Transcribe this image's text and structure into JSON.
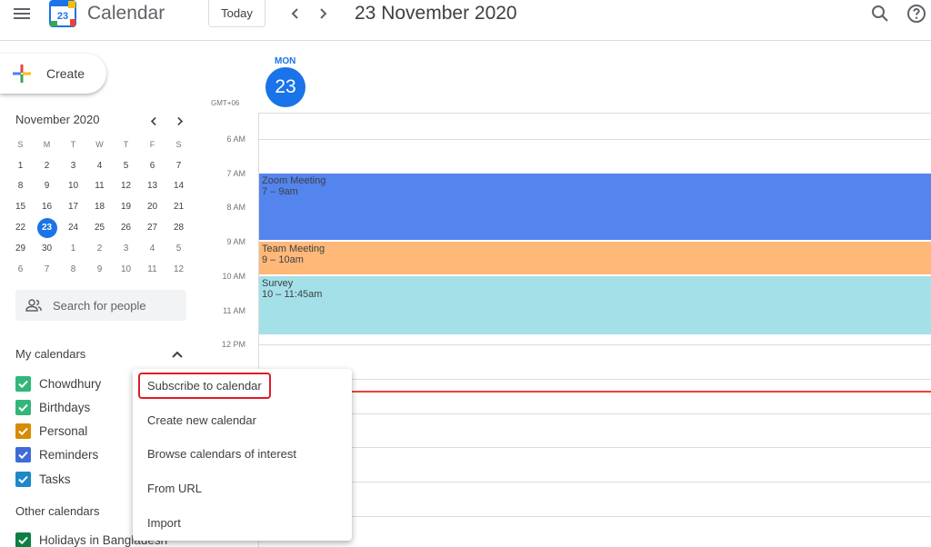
{
  "header": {
    "app_title": "Calendar",
    "logo_day": "23",
    "today_label": "Today",
    "date_title": "23 November 2020"
  },
  "sidebar": {
    "create_label": "Create",
    "mini_calendar": {
      "month_label": "November 2020",
      "weekdays": [
        "S",
        "M",
        "T",
        "W",
        "T",
        "F",
        "S"
      ],
      "weeks": [
        [
          "1",
          "2",
          "3",
          "4",
          "5",
          "6",
          "7"
        ],
        [
          "8",
          "9",
          "10",
          "11",
          "12",
          "13",
          "14"
        ],
        [
          "15",
          "16",
          "17",
          "18",
          "19",
          "20",
          "21"
        ],
        [
          "22",
          "23",
          "24",
          "25",
          "26",
          "27",
          "28"
        ],
        [
          "29",
          "30",
          "1",
          "2",
          "3",
          "4",
          "5"
        ],
        [
          "6",
          "7",
          "8",
          "9",
          "10",
          "11",
          "12"
        ]
      ],
      "selected": "23"
    },
    "people_search_placeholder": "Search for people",
    "my_calendars_title": "My calendars",
    "my_calendars": [
      {
        "label": "Chowdhury",
        "color": "#33b679"
      },
      {
        "label": "Birthdays",
        "color": "#33b679"
      },
      {
        "label": "Personal",
        "color": "#d88b00"
      },
      {
        "label": "Reminders",
        "color": "#3f6ad8"
      },
      {
        "label": "Tasks",
        "color": "#1e88c8"
      }
    ],
    "other_calendars_title": "Other calendars",
    "other_calendars": [
      {
        "label": "Holidays in Bangladesh",
        "color": "#0b8043"
      }
    ]
  },
  "day_view": {
    "dow": "MON",
    "day_number": "23",
    "timezone": "GMT+06",
    "hours": [
      "6 AM",
      "7 AM",
      "8 AM",
      "9 AM",
      "10 AM",
      "11 AM",
      "12 PM"
    ],
    "events": [
      {
        "title": "Zoom Meeting",
        "time": "7 – 9am",
        "color": "#5484ed"
      },
      {
        "title": "Team Meeting",
        "time": "9 – 10am",
        "color": "#ffb878"
      },
      {
        "title": "Survey",
        "time": "10 – 11:45am",
        "color": "#a4e0e8"
      }
    ]
  },
  "context_menu": {
    "items": [
      "Subscribe to calendar",
      "Create new calendar",
      "Browse calendars of interest",
      "From URL",
      "Import"
    ],
    "highlighted": "Subscribe to calendar"
  }
}
